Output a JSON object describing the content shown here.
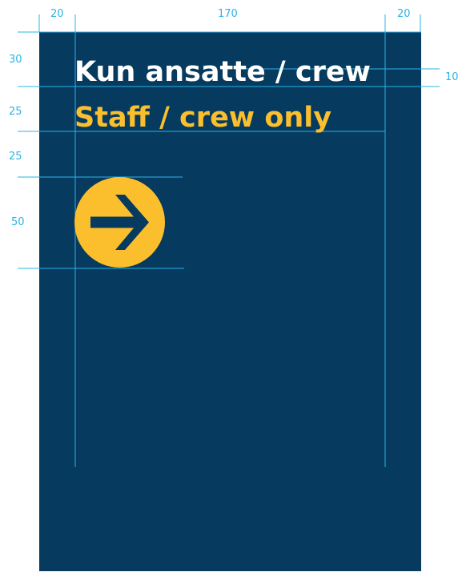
{
  "colors": {
    "panel": "#063a5f",
    "guide": "#2ab4e6",
    "label": "#2ab4e6",
    "title": "#ffffff",
    "subtitle": "#fbbf2e",
    "arrow_circle": "#fbbf2e",
    "arrow": "#063a5f"
  },
  "sign": {
    "title": "Kun ansatte / crew",
    "subtitle": "Staff / crew only",
    "icon": "arrow-right-icon"
  },
  "dimensions": {
    "margin_left": "20",
    "content_width": "170",
    "margin_right": "20",
    "top_margin": "30",
    "line_gap": "10",
    "line_height": "25",
    "icon_gap": "25",
    "icon_size": "50"
  }
}
